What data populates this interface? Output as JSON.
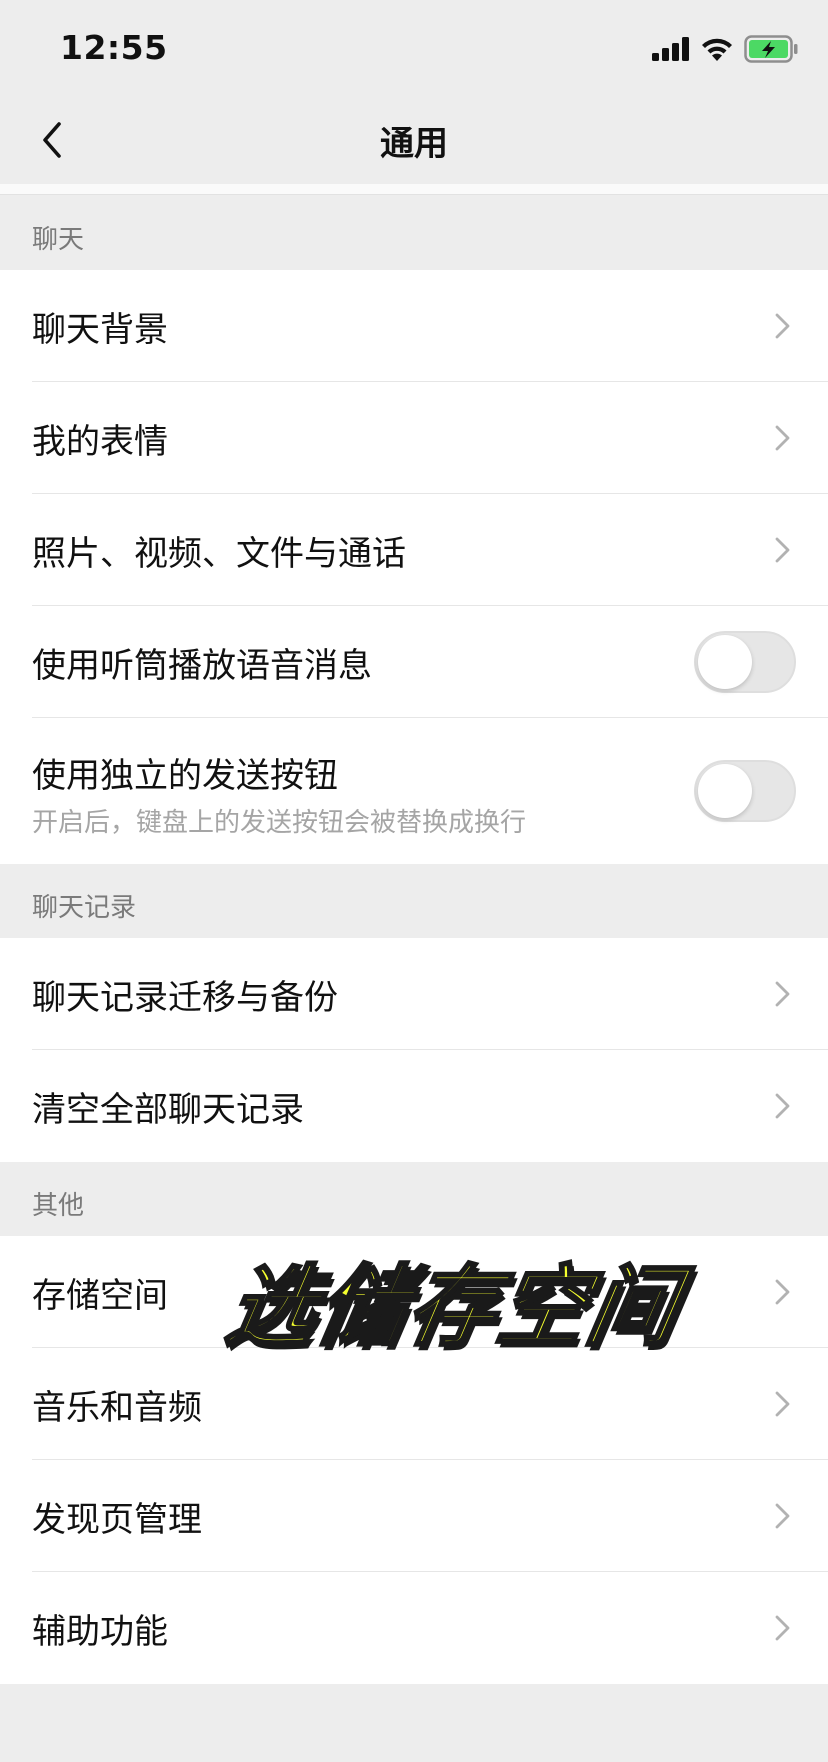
{
  "status_bar": {
    "time": "12:55",
    "icons": [
      "cellular-signal-icon",
      "wifi-icon",
      "battery-charging-icon"
    ],
    "battery_color": "#4cd964"
  },
  "nav": {
    "back_icon": "chevron-left-icon",
    "title": "通用"
  },
  "sections": {
    "chat": {
      "header": "聊天",
      "items": [
        {
          "label": "聊天背景"
        },
        {
          "label": "我的表情"
        },
        {
          "label": "照片、视频、文件与通话"
        },
        {
          "label": "使用听筒播放语音消息",
          "toggle": false
        },
        {
          "label": "使用独立的发送按钮",
          "sublabel": "开启后，键盘上的发送按钮会被替换成换行",
          "toggle": false
        }
      ]
    },
    "history": {
      "header": "聊天记录",
      "items": [
        {
          "label": "聊天记录迁移与备份"
        },
        {
          "label": "清空全部聊天记录"
        }
      ]
    },
    "other": {
      "header": "其他",
      "items": [
        {
          "label": "存储空间"
        },
        {
          "label": "音乐和音频"
        },
        {
          "label": "发现页管理"
        },
        {
          "label": "辅助功能"
        }
      ]
    }
  },
  "overlay": {
    "caption": "选储存空间",
    "color": "#f5ff2e"
  }
}
